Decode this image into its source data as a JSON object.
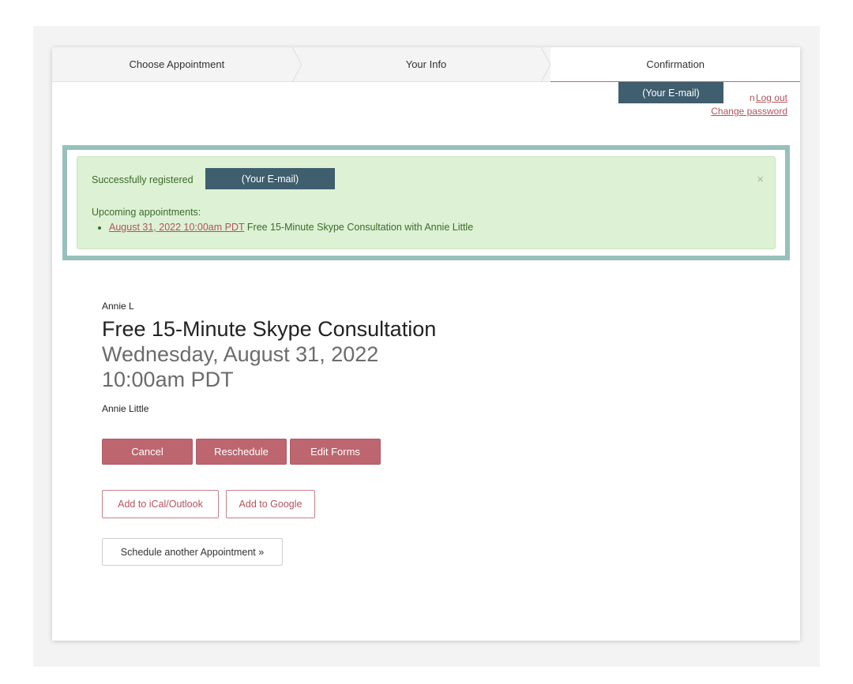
{
  "steps": [
    {
      "label": "Choose Appointment"
    },
    {
      "label": "Your Info"
    },
    {
      "label": "Confirmation"
    }
  ],
  "account": {
    "email_mask": "(Your E-mail)",
    "dot_char": "n",
    "logout": "Log out",
    "change_password": "Change password"
  },
  "alert": {
    "registered_text": "Successfully registered",
    "email_mask": "(Your E-mail)",
    "close": "×",
    "upcoming_label": "Upcoming appointments:",
    "appointment_link": "August 31, 2022 10:00am PDT",
    "appointment_desc": " Free 15-Minute Skype Consultation with Annie Little"
  },
  "appointment": {
    "provider_short": "Annie L",
    "title": "Free 15-Minute Skype Consultation",
    "date": "Wednesday, August 31, 2022",
    "time": "10:00am PDT",
    "provider_full": "Annie Little"
  },
  "buttons": {
    "cancel": "Cancel",
    "reschedule": "Reschedule",
    "edit_forms": "Edit Forms",
    "add_ical": "Add to iCal/Outlook",
    "add_google": "Add to Google",
    "schedule_another": "Schedule another Appointment »"
  },
  "colors": {
    "accent": "#bd6670",
    "alert_bg": "#ddf1d4",
    "alert_frame": "#97c0bd",
    "mask": "#3f5e6e"
  }
}
